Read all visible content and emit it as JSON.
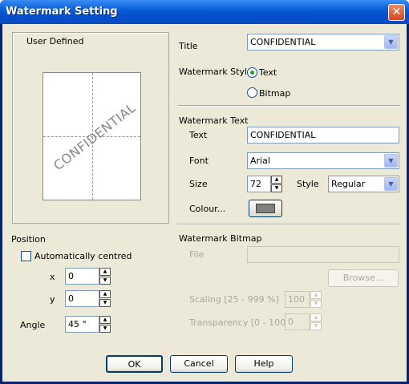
{
  "window": {
    "title": "Watermark Setting",
    "close_glyph": "✕"
  },
  "preview": {
    "label": "User Defined",
    "watermark_text": "CONFIDENTIAL"
  },
  "title_field": {
    "label": "Title",
    "value": "CONFIDENTIAL"
  },
  "watermark_style": {
    "label": "Watermark Style",
    "options": [
      "Text",
      "Bitmap"
    ],
    "selected": "Text"
  },
  "watermark_text": {
    "section_label": "Watermark Text",
    "text_label": "Text",
    "text_value": "CONFIDENTIAL",
    "font_label": "Font",
    "font_value": "Arial",
    "size_label": "Size",
    "size_value": "72",
    "style_label": "Style",
    "style_value": "Regular",
    "colour_label": "Colour...",
    "colour_value": "#808080"
  },
  "watermark_bitmap": {
    "section_label": "Watermark Bitmap",
    "file_label": "File",
    "file_value": "",
    "browse_label": "Browse...",
    "scaling_label": "Scaling [25 - 999 %]",
    "scaling_value": "100",
    "transparency_label": "Transparency [0 - 100 %]",
    "transparency_value": "0"
  },
  "position": {
    "label": "Position",
    "auto_centred_label": "Automatically centred",
    "x_label": "x",
    "x_value": "0",
    "y_label": "y",
    "y_value": "0",
    "angle_label": "Angle",
    "angle_value": "45 °"
  },
  "buttons": {
    "ok": "OK",
    "cancel": "Cancel",
    "help": "Help"
  }
}
